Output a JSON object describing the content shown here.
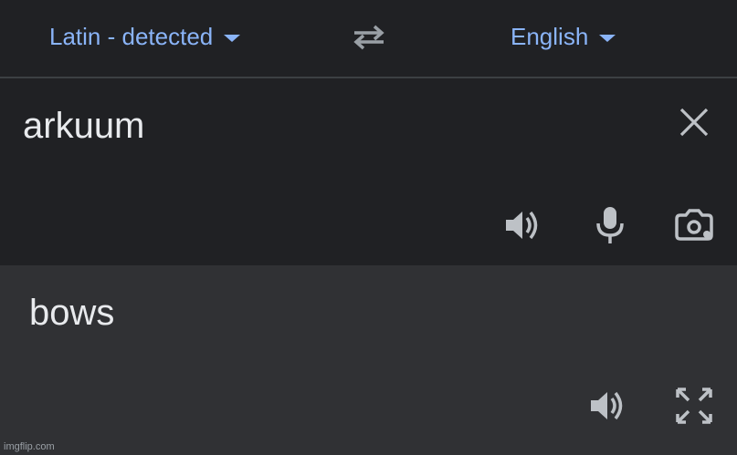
{
  "languages": {
    "source_label": "Latin - detected",
    "target_label": "English"
  },
  "input": {
    "text": "arkuum"
  },
  "output": {
    "text": "bows"
  },
  "icons": {
    "swap": "swap-languages-icon",
    "clear": "close-icon",
    "input_listen": "speaker-icon",
    "mic": "microphone-icon",
    "camera": "camera-translate-icon",
    "output_listen": "speaker-icon",
    "fullscreen": "fullscreen-icon"
  },
  "colors": {
    "background": "#202124",
    "output_background": "#303134",
    "accent": "#8ab4f8",
    "text": "#e8eaed",
    "icon": "#bdc1c6"
  },
  "watermark": "imgflip.com"
}
